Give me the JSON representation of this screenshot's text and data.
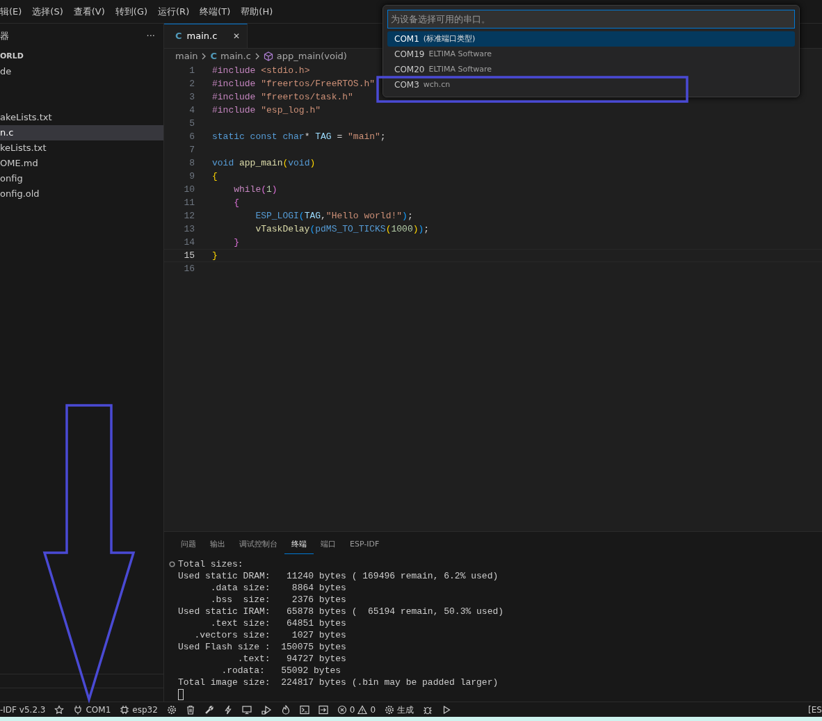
{
  "menu": [
    "辑(E)",
    "选择(S)",
    "查看(V)",
    "转到(G)",
    "运行(R)",
    "终端(T)",
    "帮助(H)"
  ],
  "sidebar": {
    "title": "器",
    "more": "···",
    "items": [
      {
        "label": "ORLD",
        "kind": "folder",
        "selected": false
      },
      {
        "label": "de",
        "kind": "file",
        "selected": false
      },
      {
        "label": "akeLists.txt",
        "kind": "file",
        "selected": false
      },
      {
        "label": "n.c",
        "kind": "file",
        "selected": true
      },
      {
        "label": "keLists.txt",
        "kind": "file",
        "selected": false
      },
      {
        "label": "OME.md",
        "kind": "file",
        "selected": false
      },
      {
        "label": "onfig",
        "kind": "file",
        "selected": false
      },
      {
        "label": "onfig.old",
        "kind": "file",
        "selected": false
      }
    ]
  },
  "editor_tabs": [
    {
      "icon_letter": "C",
      "label": "main.c",
      "close": "✕",
      "selected": true
    }
  ],
  "breadcrumb": {
    "folder": "main",
    "file_letter": "C",
    "file": "main.c",
    "symbol": "app_main(void)"
  },
  "code": [
    {
      "number": "1",
      "current": false,
      "tokens": [
        {
          "text": "#include",
          "kind": "directive"
        },
        {
          "text": " <stdio.h>",
          "kind": "string"
        }
      ]
    },
    {
      "number": "2",
      "current": false,
      "tokens": [
        {
          "text": "#include",
          "kind": "directive"
        },
        {
          "text": " \"freertos/FreeRTOS.h\"",
          "kind": "string"
        }
      ]
    },
    {
      "number": "3",
      "current": false,
      "tokens": [
        {
          "text": "#include",
          "kind": "directive"
        },
        {
          "text": " \"freertos/task.h\"",
          "kind": "string"
        }
      ]
    },
    {
      "number": "4",
      "current": false,
      "tokens": [
        {
          "text": "#include",
          "kind": "directive"
        },
        {
          "text": " \"esp_log.h\"",
          "kind": "string"
        }
      ]
    },
    {
      "number": "5",
      "current": false
    },
    {
      "number": "6",
      "current": false,
      "tokens": [
        {
          "text": "static const char",
          "kind": "keyword"
        },
        {
          "text": "* ",
          "kind": "plain"
        },
        {
          "text": "TAG",
          "kind": "var"
        },
        {
          "text": " = ",
          "kind": "plain"
        },
        {
          "text": "\"main\"",
          "kind": "string"
        },
        {
          "text": ";",
          "kind": "plain"
        }
      ]
    },
    {
      "number": "7",
      "current": false
    },
    {
      "number": "8",
      "current": false,
      "tokens": [
        {
          "text": "void",
          "kind": "keyword"
        },
        {
          "text": " app_main",
          "kind": "func"
        },
        {
          "text": "(",
          "kind": "bracket1"
        },
        {
          "text": "void",
          "kind": "keyword"
        },
        {
          "text": ")",
          "kind": "bracket1"
        }
      ]
    },
    {
      "number": "9",
      "current": false,
      "tokens": [
        {
          "text": "{",
          "kind": "bracket1"
        }
      ]
    },
    {
      "number": "10",
      "current": false,
      "tokens": [
        {
          "text": "    while",
          "kind": "directive"
        },
        {
          "text": "(",
          "kind": "bracket2"
        },
        {
          "text": "1",
          "kind": "number"
        },
        {
          "text": ")",
          "kind": "bracket2"
        }
      ]
    },
    {
      "number": "11",
      "current": false,
      "tokens": [
        {
          "text": "    {",
          "kind": "bracket2"
        }
      ]
    },
    {
      "number": "12",
      "current": false,
      "tokens": [
        {
          "text": "        ESP_LOGI",
          "kind": "macro"
        },
        {
          "text": "(",
          "kind": "bracket3"
        },
        {
          "text": "TAG",
          "kind": "var"
        },
        {
          "text": ",",
          "kind": "plain"
        },
        {
          "text": "\"Hello world!\"",
          "kind": "string"
        },
        {
          "text": ")",
          "kind": "bracket3"
        },
        {
          "text": ";",
          "kind": "plain"
        }
      ]
    },
    {
      "number": "13",
      "current": false,
      "tokens": [
        {
          "text": "        vTaskDelay",
          "kind": "func"
        },
        {
          "text": "(",
          "kind": "bracket3"
        },
        {
          "text": "pdMS_TO_TICKS",
          "kind": "macro"
        },
        {
          "text": "(",
          "kind": "bracket1"
        },
        {
          "text": "1000",
          "kind": "number"
        },
        {
          "text": ")",
          "kind": "bracket1"
        },
        {
          "text": ")",
          "kind": "bracket3"
        },
        {
          "text": ";",
          "kind": "plain"
        }
      ]
    },
    {
      "number": "14",
      "current": false,
      "tokens": [
        {
          "text": "    }",
          "kind": "bracket2"
        }
      ]
    },
    {
      "number": "15",
      "current": true,
      "tokens": [
        {
          "text": "}",
          "kind": "bracket1"
        }
      ]
    },
    {
      "number": "16",
      "current": false
    }
  ],
  "panel_tabs": [
    {
      "label": "问题",
      "selected": false
    },
    {
      "label": "输出",
      "selected": false
    },
    {
      "label": "调试控制台",
      "selected": false
    },
    {
      "label": "终端",
      "selected": true
    },
    {
      "label": "端口",
      "selected": false
    },
    {
      "label": "ESP-IDF",
      "selected": false
    }
  ],
  "terminal": [
    "Total sizes:",
    "Used static DRAM:   11240 bytes ( 169496 remain, 6.2% used)",
    "      .data size:    8864 bytes",
    "      .bss  size:    2376 bytes",
    "Used static IRAM:   65878 bytes (  65194 remain, 50.3% used)",
    "      .text size:   64851 bytes",
    "   .vectors size:    1027 bytes",
    "Used Flash size :  150075 bytes",
    "           .text:   94727 bytes",
    "        .rodata:   55092 bytes",
    "Total image size:  224817 bytes (.bin may be padded larger)"
  ],
  "quick_pick": {
    "placeholder": "为设备选择可用的串口。",
    "items": [
      {
        "port": "COM1",
        "detail": "(标准端口类型)",
        "selected": true
      },
      {
        "port": "COM19",
        "detail": "ELTIMA Software",
        "selected": false
      },
      {
        "port": "COM20",
        "detail": "ELTIMA Software",
        "selected": false
      },
      {
        "port": "COM3",
        "detail": "wch.cn",
        "selected": false
      }
    ]
  },
  "annotations": {
    "highlight_box": true,
    "down_arrow": true
  },
  "status_bar": {
    "idf_version": "-IDF v5.2.3",
    "port": "COM1",
    "target": "esp32",
    "errors": "0",
    "warnings": "0",
    "build": "生成",
    "trailing": "[ES"
  }
}
